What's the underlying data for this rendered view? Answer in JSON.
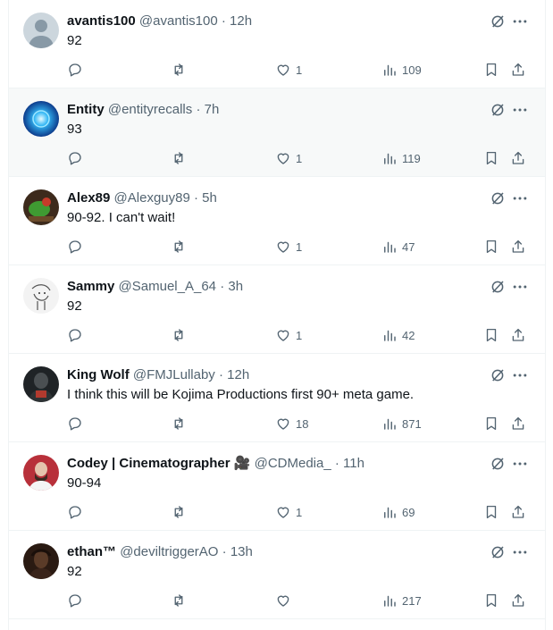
{
  "colors": {
    "text": "#0f1419",
    "secondary": "#536471",
    "border": "#eff3f4",
    "highlight": "#f7f9f9"
  },
  "icons": [
    "reply-icon",
    "retweet-icon",
    "like-icon",
    "views-icon",
    "bookmark-icon",
    "share-icon",
    "grok-icon",
    "more-icon"
  ],
  "tweets": [
    {
      "name": "avantis100",
      "handle": "@avantis100",
      "sep": "·",
      "time": "12h",
      "text": "92",
      "replies": "",
      "retweets": "",
      "likes": "1",
      "views": "109",
      "avatar": "default"
    },
    {
      "name": "Entity",
      "handle": "@entityrecalls",
      "sep": "·",
      "time": "7h",
      "text": "93",
      "replies": "",
      "retweets": "",
      "likes": "1",
      "views": "119",
      "avatar": "blue-orb"
    },
    {
      "name": "Alex89",
      "handle": "@Alexguy89",
      "sep": "·",
      "time": "5h",
      "text": "90-92. I can't wait!",
      "replies": "",
      "retweets": "",
      "likes": "1",
      "views": "47",
      "avatar": "green-character"
    },
    {
      "name": "Sammy",
      "handle": "@Samuel_A_64",
      "sep": "·",
      "time": "3h",
      "text": "92",
      "replies": "",
      "retweets": "",
      "likes": "1",
      "views": "42",
      "avatar": "sketch"
    },
    {
      "name": "King Wolf",
      "handle": "@FMJLullaby",
      "sep": "·",
      "time": "12h",
      "text": "I think this will be Kojima Productions first 90+ meta game.",
      "replies": "",
      "retweets": "",
      "likes": "18",
      "views": "871",
      "avatar": "dark-soldier"
    },
    {
      "name": "Codey | Cinematographer 🎥",
      "handle": "@CDMedia_",
      "sep": "·",
      "time": "11h",
      "text": "90-94",
      "replies": "",
      "retweets": "",
      "likes": "1",
      "views": "69",
      "avatar": "red-portrait"
    },
    {
      "name": "ethan™",
      "handle": "@deviltriggerAO",
      "sep": "·",
      "time": "13h",
      "text": "92",
      "replies": "",
      "retweets": "",
      "likes": "",
      "views": "217",
      "avatar": "dark-figure"
    }
  ]
}
